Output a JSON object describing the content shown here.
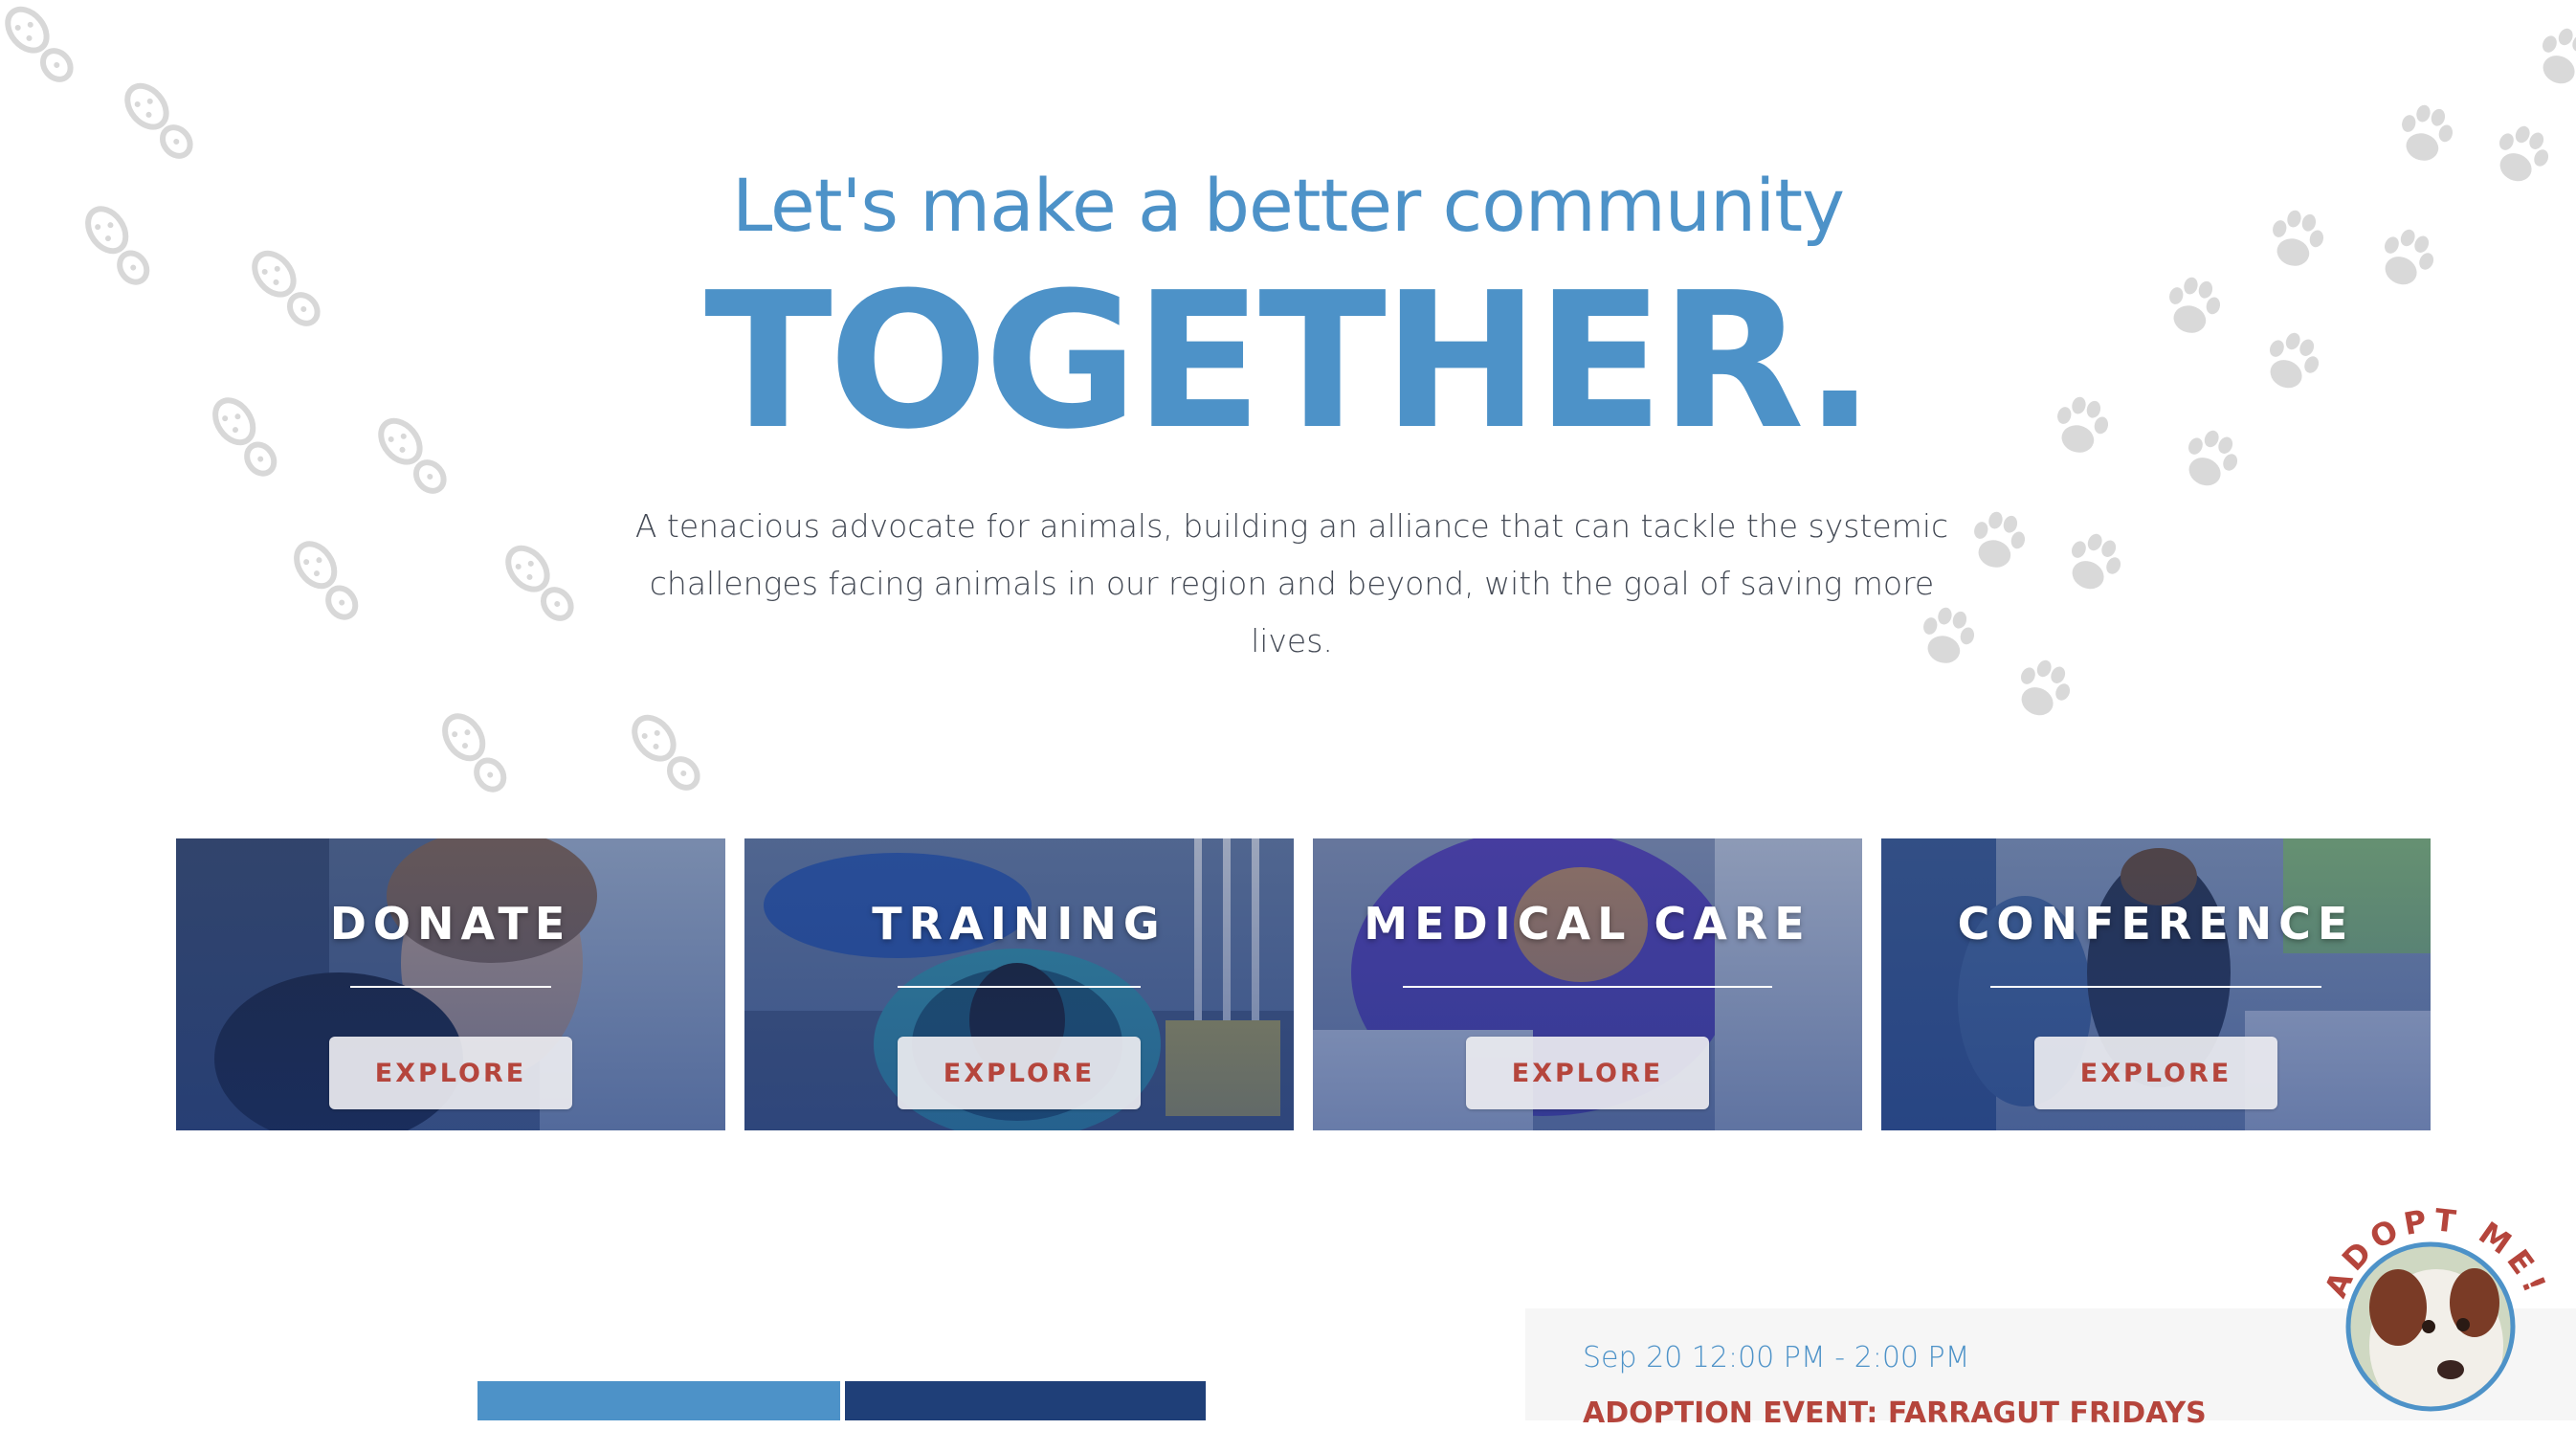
{
  "hero": {
    "subtitle": "Let's make a better community",
    "headline": "TOGETHER.",
    "tagline_line1": "A tenacious advocate for animals, building an alliance that can tackle the systemic",
    "tagline_line2": "challenges facing animals in our region and beyond, with the goal of saving more lives."
  },
  "cards": [
    {
      "title": "DONATE",
      "button": "EXPLORE"
    },
    {
      "title": "TRAINING",
      "button": "EXPLORE"
    },
    {
      "title": "MEDICAL CARE",
      "button": "EXPLORE"
    },
    {
      "title": "CONFERENCE",
      "button": "EXPLORE"
    }
  ],
  "event": {
    "date": "Sep 20 12:00 PM - 2:00 PM",
    "title": "ADOPTION EVENT: FARRAGUT FRIDAYS"
  },
  "adopt_badge": {
    "label": "ADOPT ME!"
  },
  "colors": {
    "brand_blue": "#4d92c8",
    "navy": "#1f3f78",
    "accent_red": "#b5453c",
    "print_gray": "#d9d9d9"
  },
  "icons": [
    "boot-print-icon",
    "paw-print-icon"
  ]
}
